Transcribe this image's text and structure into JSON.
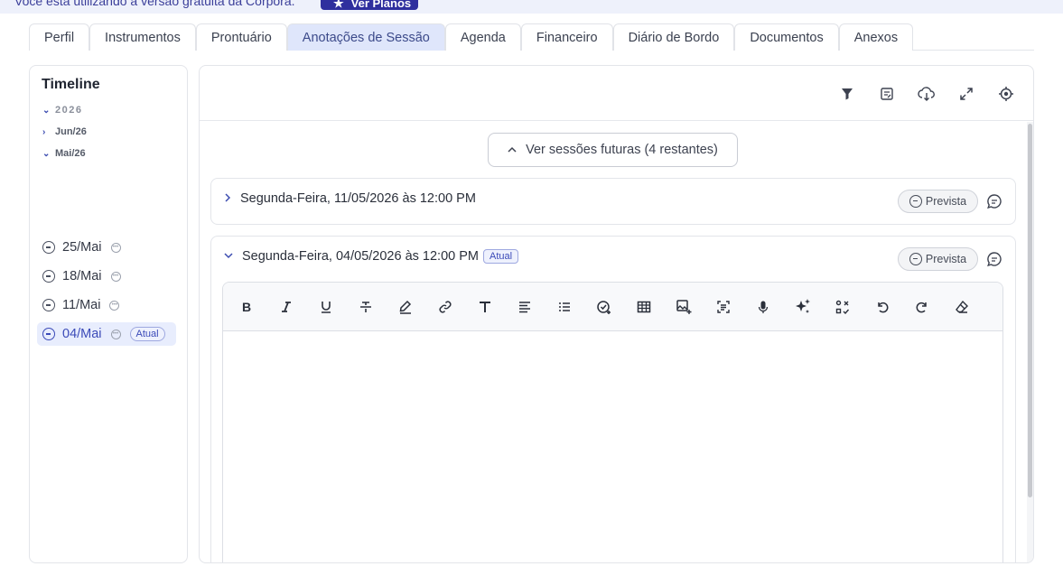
{
  "banner": {
    "text": "Você está utilizando a versão gratuita da Corpora.",
    "button_label": "Ver Planos"
  },
  "tabs": [
    {
      "label": "Perfil"
    },
    {
      "label": "Instrumentos"
    },
    {
      "label": "Prontuário"
    },
    {
      "label": "Anotações de Sessão",
      "active": true
    },
    {
      "label": "Agenda"
    },
    {
      "label": "Financeiro"
    },
    {
      "label": "Diário de Bordo"
    },
    {
      "label": "Documentos"
    },
    {
      "label": "Anexos"
    }
  ],
  "timeline": {
    "title": "Timeline",
    "year": "2026",
    "months": [
      "Jun/26",
      "Mai/26"
    ],
    "sessions": [
      {
        "label": "25/Mai"
      },
      {
        "label": "18/Mai"
      },
      {
        "label": "11/Mai"
      },
      {
        "label": "04/Mai",
        "badge": "Atual"
      }
    ]
  },
  "main": {
    "future_button": "Ver sessões futuras (4 restantes)",
    "toolbar_icons": [
      "filter-icon",
      "notes-icon",
      "cloud-download-icon",
      "expand-icon",
      "target-icon"
    ],
    "cards": [
      {
        "date": "Segunda-Feira, 11/05/2026 às 12:00 PM",
        "status": "Prevista",
        "expanded": false
      },
      {
        "date": "Segunda-Feira, 04/05/2026 às 12:00 PM",
        "badge": "Atual",
        "status": "Prevista",
        "expanded": true
      }
    ],
    "editor_tools": [
      "bold-icon",
      "italic-icon",
      "underline-icon",
      "strikethrough-icon",
      "highlight-icon",
      "link-icon",
      "text-format-icon",
      "align-icon",
      "list-icon",
      "checklist-icon",
      "table-icon",
      "image-icon",
      "scan-text-icon",
      "microphone-icon",
      "ai-sparkle-icon",
      "transform-icon",
      "undo-icon",
      "redo-icon",
      "eraser-icon"
    ]
  },
  "colors": {
    "accent": "#3b4ab8",
    "active_tab_bg": "#dfe6fb",
    "banner_button": "#2f2f9e"
  }
}
